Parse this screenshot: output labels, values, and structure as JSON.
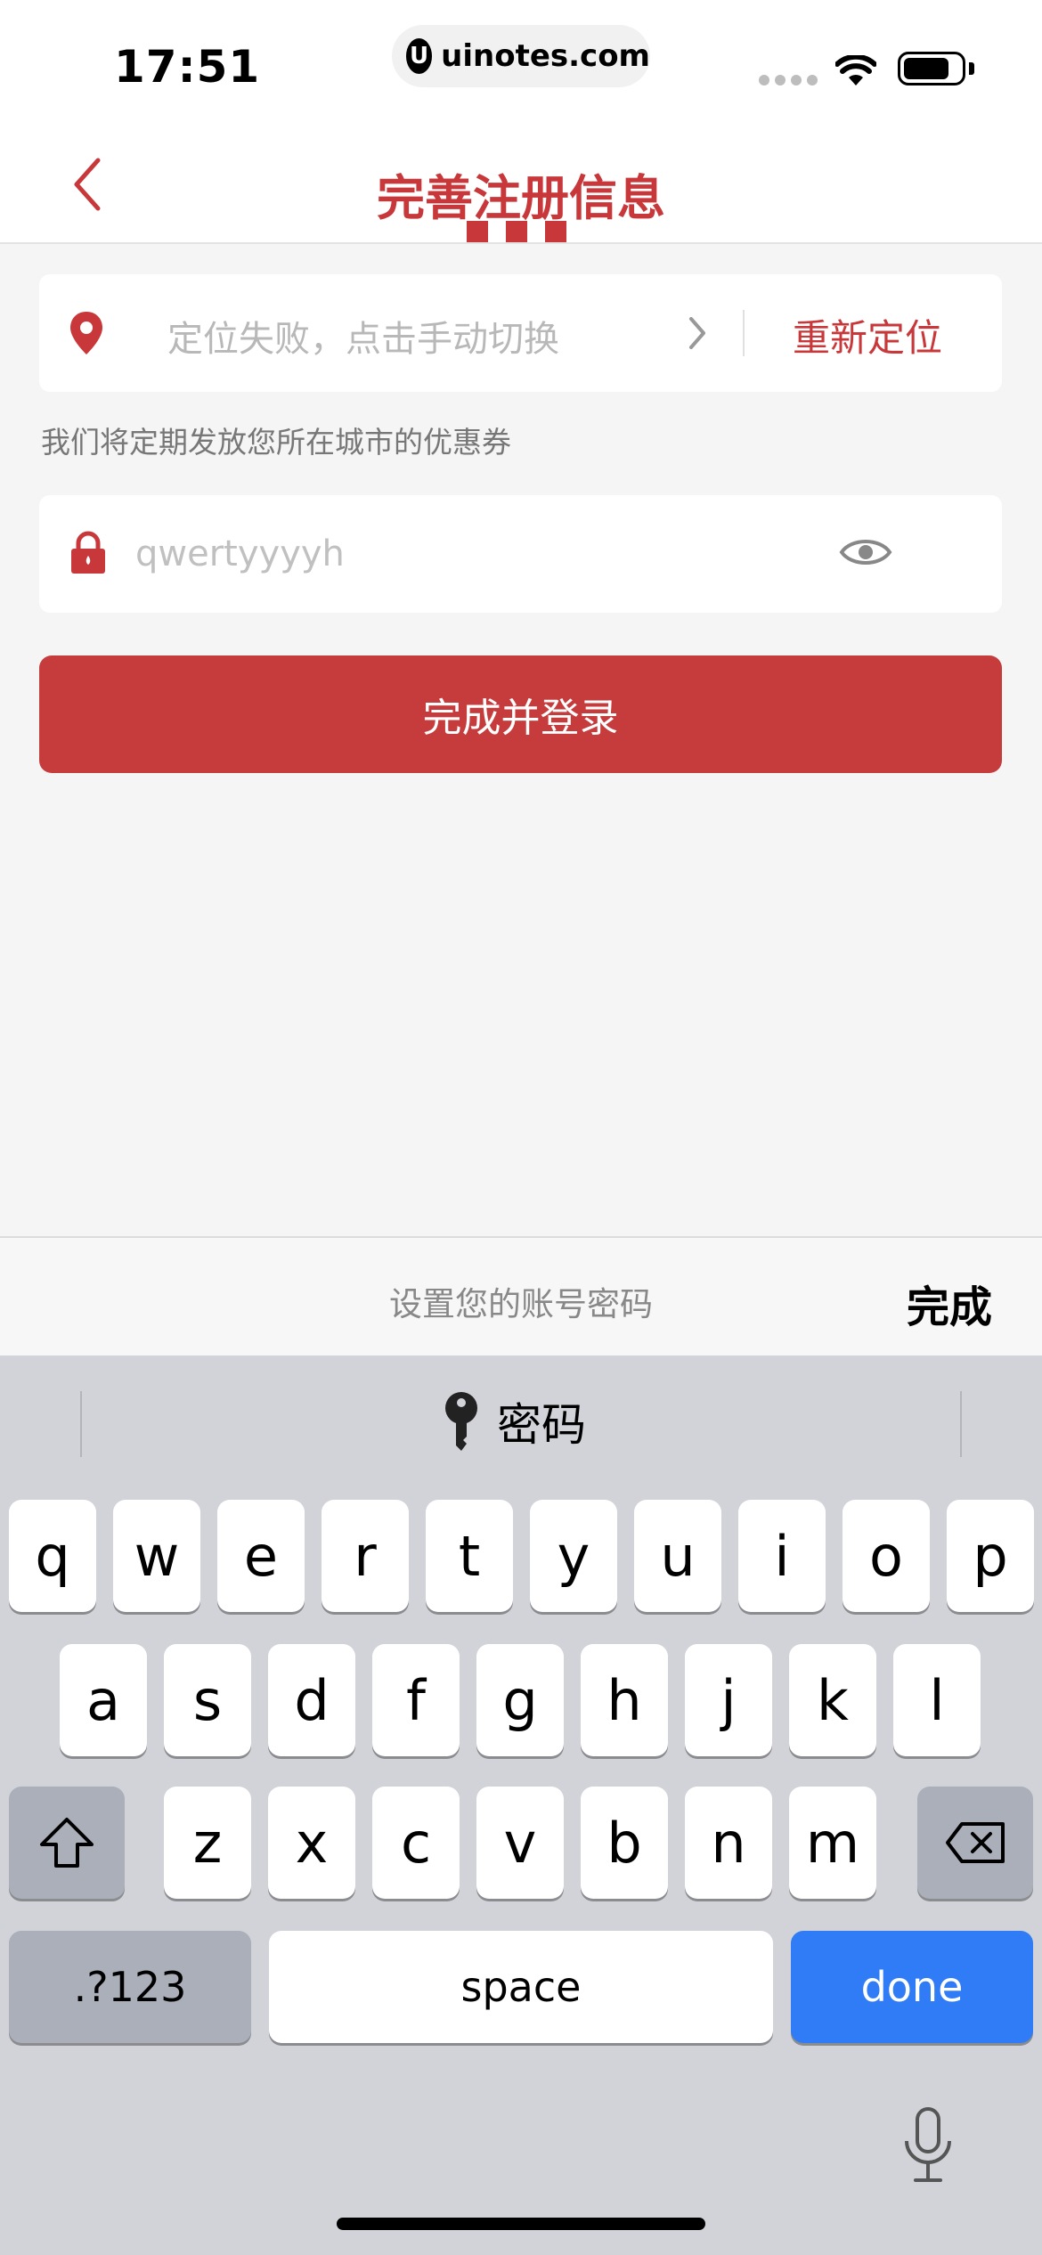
{
  "status_bar": {
    "time": "17:51",
    "url": "uinotes.com",
    "url_logo": "U"
  },
  "nav": {
    "title": "完善注册信息",
    "back_icon": "chevron-left-icon"
  },
  "location": {
    "placeholder": "定位失败，点击手动切换",
    "relocate_label": "重新定位"
  },
  "hint_text": "我们将定期发放您所在城市的优惠券",
  "password": {
    "value": "",
    "placeholder": "qwertyyyyh"
  },
  "submit_label": "完成并登录",
  "accessory": {
    "hint": "设置您的账号密码",
    "done_label": "完成"
  },
  "keyboard": {
    "suggestion_label": "密码",
    "row1": [
      "q",
      "w",
      "e",
      "r",
      "t",
      "y",
      "u",
      "i",
      "o",
      "p"
    ],
    "row2": [
      "a",
      "s",
      "d",
      "f",
      "g",
      "h",
      "j",
      "k",
      "l"
    ],
    "row3": [
      "z",
      "x",
      "c",
      "v",
      "b",
      "n",
      "m"
    ],
    "numbers_label": ".?123",
    "space_label": "space",
    "done_label": "done"
  },
  "colors": {
    "brand_red": "#c8383b",
    "keyboard_blue": "#2f7cf6"
  }
}
